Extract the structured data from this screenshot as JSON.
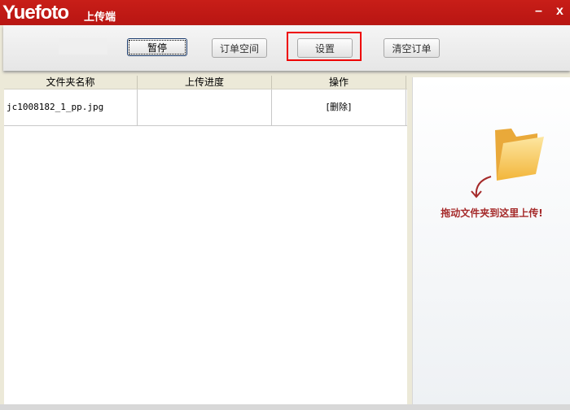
{
  "app": {
    "logo": "Yuefoto",
    "subtitle": "上传端",
    "minimize": "–",
    "close": "x"
  },
  "toolbar": {
    "pause": "暂停",
    "order_space": "订单空间",
    "settings": "设置",
    "clear_orders": "清空订单"
  },
  "table": {
    "headers": [
      "文件夹名称",
      "上传进度",
      "操作"
    ],
    "rows": [
      {
        "name": "jc1008182_1_pp.jpg",
        "progress": "",
        "action": "[删除]"
      }
    ]
  },
  "drop_zone": {
    "text": "拖动文件夹到这里上传!"
  },
  "colors": {
    "titlebar": "#c01a15",
    "highlight": "#ee0000",
    "drop_text": "#a52a2a"
  }
}
